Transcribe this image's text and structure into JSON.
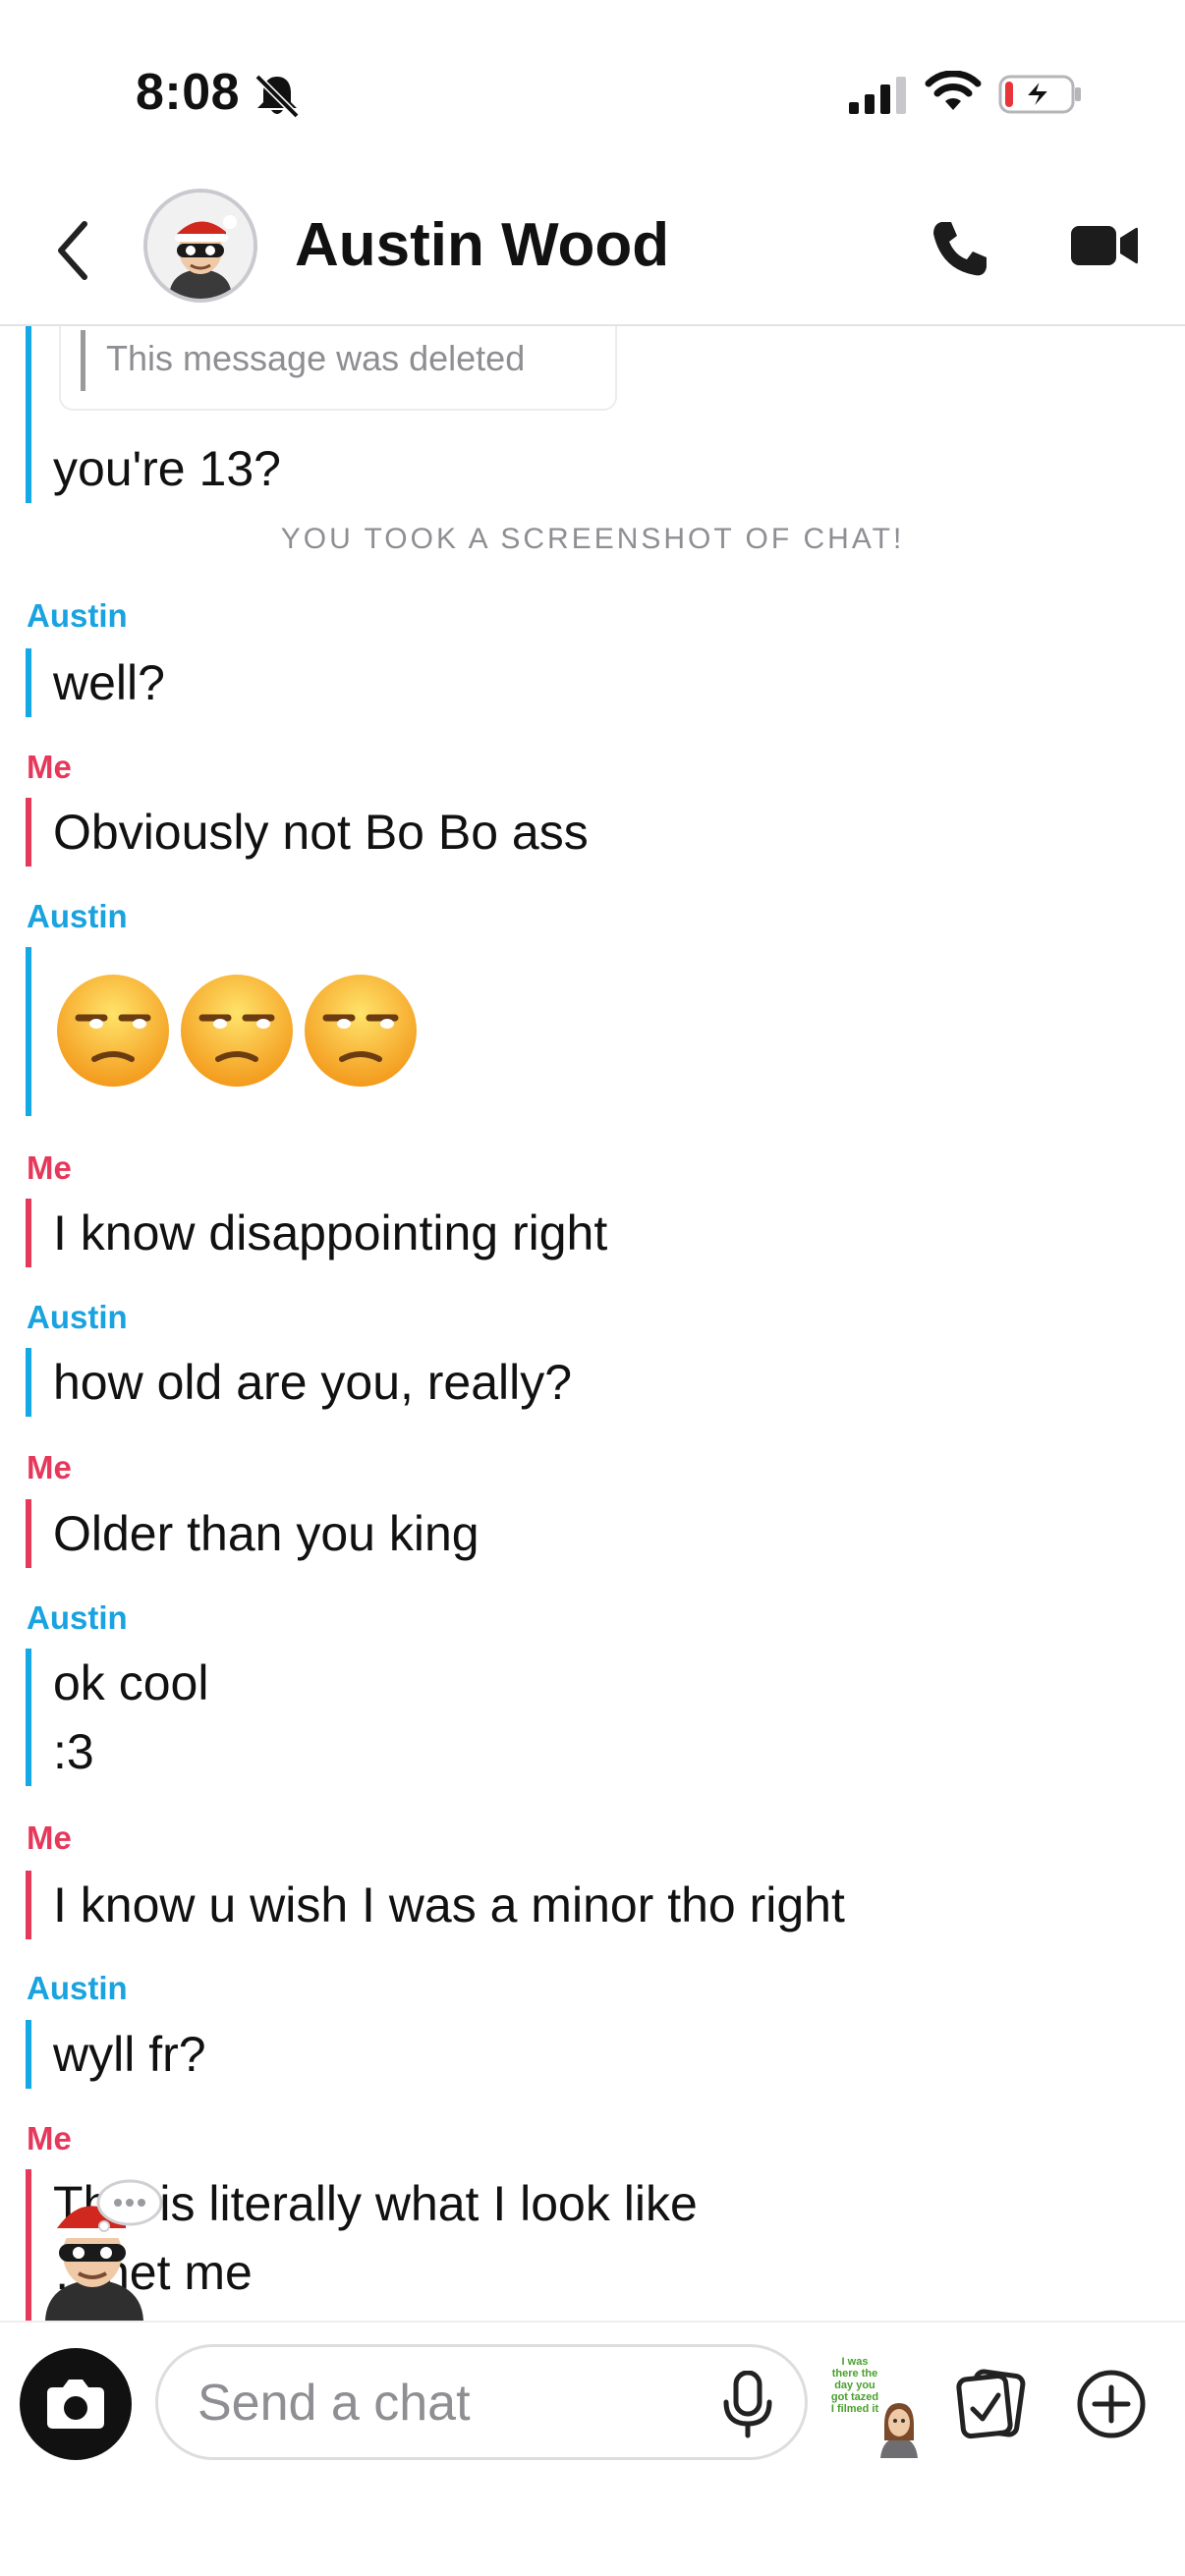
{
  "status_bar": {
    "time": "8:08",
    "icons": [
      "bell-slash-icon",
      "cellular-signal-icon",
      "wifi-icon",
      "battery-charging-icon"
    ]
  },
  "header": {
    "contact_name": "Austin Wood",
    "icons": [
      "chevron-left-icon",
      "phone-icon",
      "video-camera-icon"
    ]
  },
  "chat": {
    "deleted_note": "This message was deleted",
    "top_message": "you're 13?",
    "screenshot_note": "YOU TOOK A SCREENSHOT OF CHAT!",
    "messages": [
      {
        "sender": "Austin",
        "text": "well?"
      },
      {
        "sender": "Me",
        "text": "Obviously not Bo Bo ass"
      },
      {
        "sender": "Austin",
        "text": "",
        "emoji": [
          "unamused-face",
          "unamused-face",
          "unamused-face"
        ]
      },
      {
        "sender": "Me",
        "text": "I know disappointing right"
      },
      {
        "sender": "Austin",
        "text": "how old are you, really?"
      },
      {
        "sender": "Me",
        "text": "Older than you king"
      },
      {
        "sender": "Austin",
        "text": "ok cool\n:3"
      },
      {
        "sender": "Me",
        "text": "I know u wish I was a minor tho right"
      },
      {
        "sender": "Austin",
        "text": "wyll fr?"
      },
      {
        "sender": "Me",
        "text": "This is literally what I look like\n…net me"
      }
    ]
  },
  "composer": {
    "placeholder": "Send a chat",
    "sticker_text": "I was\nthere the\nday you\ngot tazed\nI filmed it"
  },
  "colors": {
    "austin": "#1aa3e0",
    "me": "#e6385b",
    "muted": "#8e8e93"
  }
}
